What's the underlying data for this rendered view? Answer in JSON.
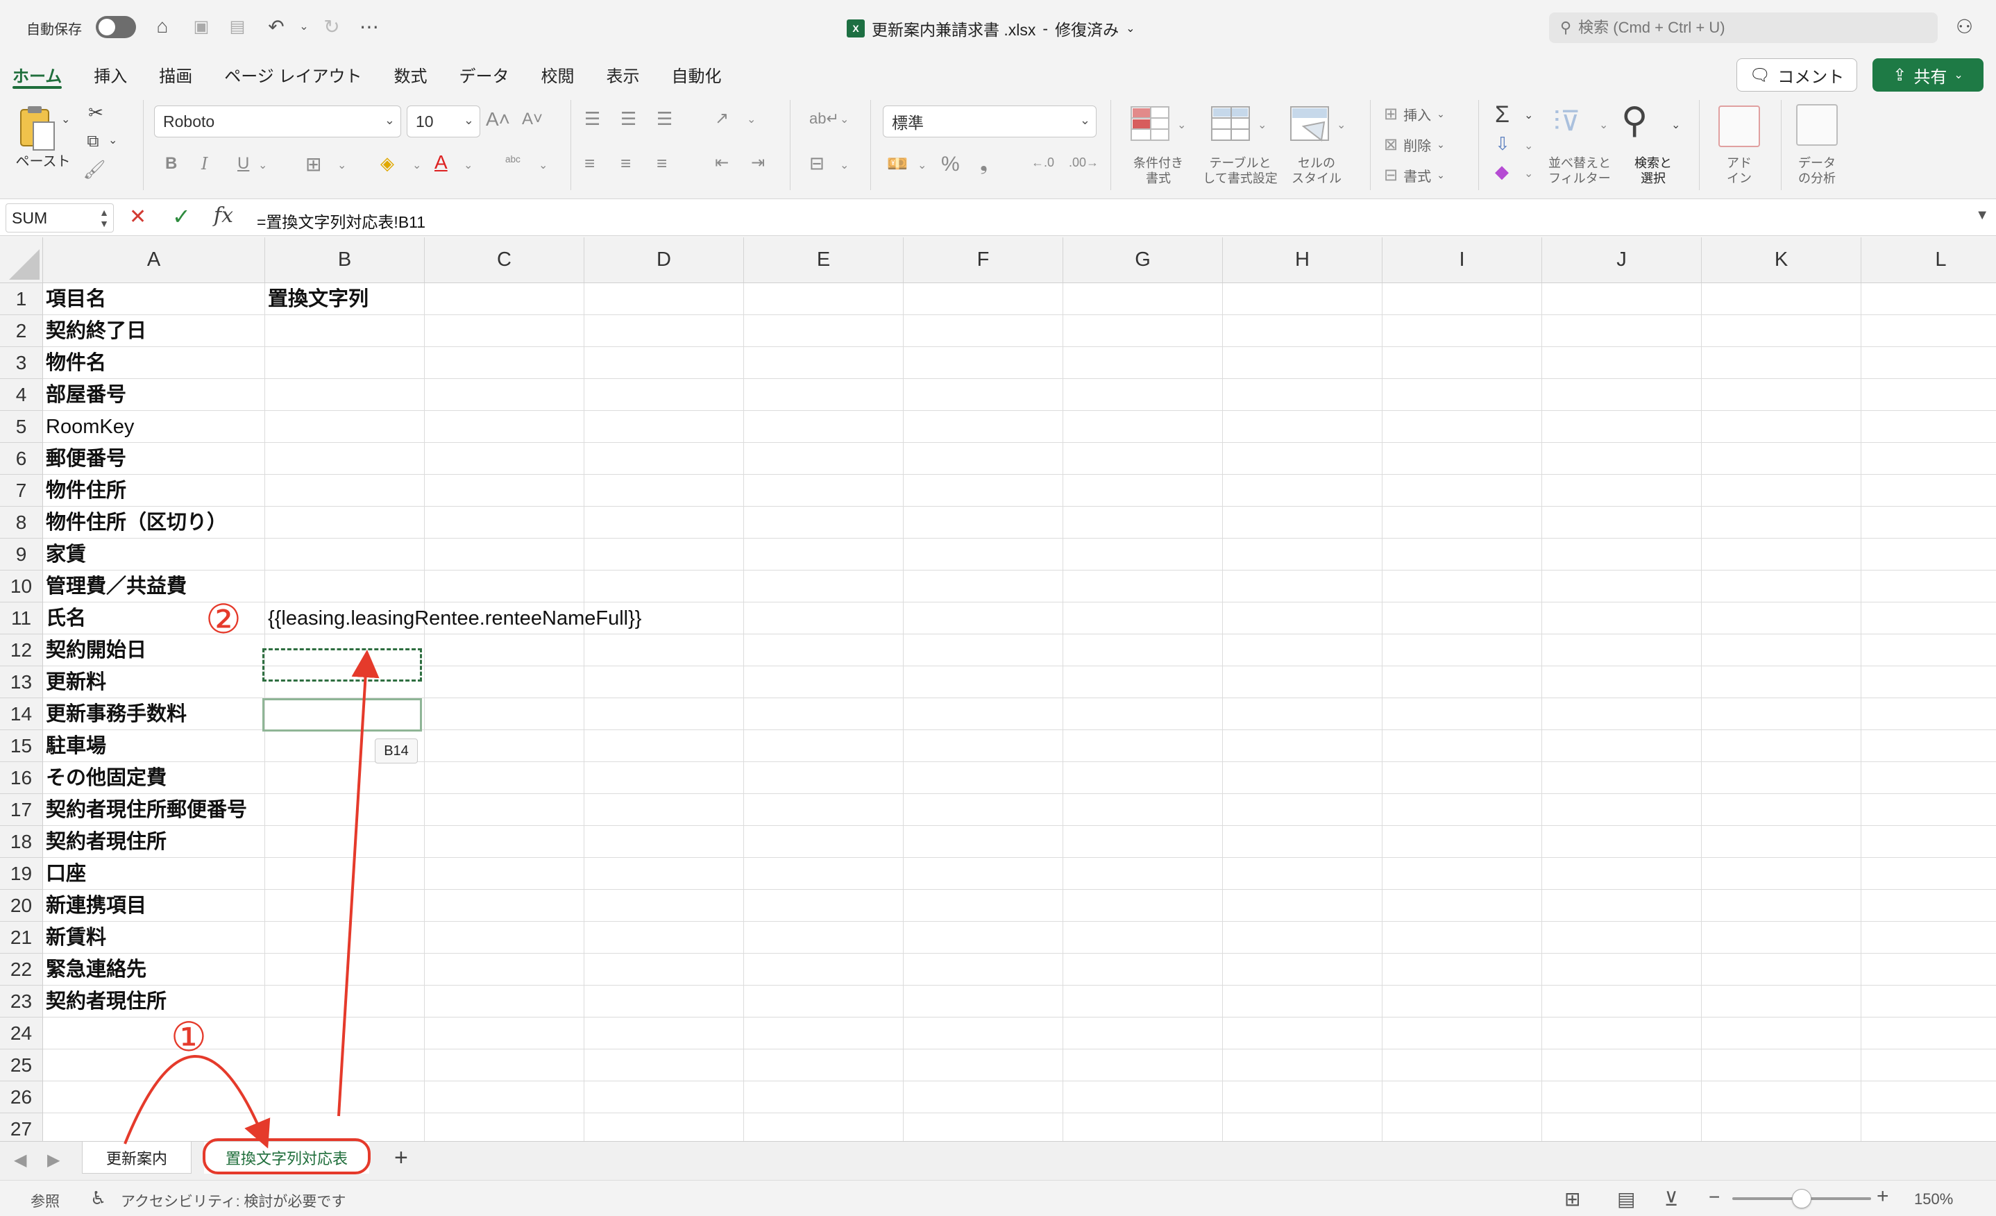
{
  "titlebar": {
    "autosave_label": "自動保存",
    "document_title": "更新案内兼請求書 .xlsx",
    "title_sep": "-",
    "status": "修復済み",
    "search_placeholder": "検索 (Cmd + Ctrl + U)"
  },
  "ribbon_tabs": [
    "ホーム",
    "挿入",
    "描画",
    "ページ レイアウト",
    "数式",
    "データ",
    "校閲",
    "表示",
    "自動化"
  ],
  "actions": {
    "comment": "コメント",
    "share": "共有"
  },
  "ribbon": {
    "paste_label": "ペースト",
    "font_name": "Roboto",
    "font_size": "10",
    "number_format": "標準",
    "cond_format": [
      "条件付き",
      "書式"
    ],
    "table_format": [
      "テーブルと",
      "して書式設定"
    ],
    "cell_style": [
      "セルの",
      "スタイル"
    ],
    "insert": "挿入",
    "delete": "削除",
    "format": "書式",
    "sort_filter": [
      "並べ替えと",
      "フィルター"
    ],
    "find_select": [
      "検索と",
      "選択"
    ],
    "addin": [
      "アド",
      "イン"
    ],
    "analyze": [
      "データ",
      "の分析"
    ]
  },
  "formula_bar": {
    "name_box": "SUM",
    "formula": "=置換文字列対応表!B11"
  },
  "grid": {
    "columns": [
      "A",
      "B",
      "C",
      "D",
      "E",
      "F",
      "G",
      "H",
      "I",
      "J",
      "K",
      "L"
    ],
    "rows": [
      "1",
      "2",
      "3",
      "4",
      "5",
      "6",
      "7",
      "8",
      "9",
      "10",
      "11",
      "12",
      "13",
      "14",
      "15",
      "16",
      "17",
      "18",
      "19",
      "20",
      "21",
      "22",
      "23",
      "24",
      "25",
      "26",
      "27"
    ],
    "col_a": [
      "項目名",
      "契約終了日",
      "物件名",
      "部屋番号",
      "RoomKey",
      "郵便番号",
      "物件住所",
      "物件住所（区切り）",
      "家賃",
      "管理費／共益費",
      "氏名",
      "契約開始日",
      "更新料",
      "更新事務手数料",
      "駐車場",
      "その他固定費",
      "契約者現住所郵便番号",
      "契約者現住所",
      "口座",
      "新連携項目",
      "新賃料",
      "緊急連絡先",
      "契約者現住所",
      "",
      "",
      "",
      ""
    ],
    "col_b": [
      "置換文字列",
      "",
      "",
      "",
      "",
      "",
      "",
      "",
      "",
      "",
      "{{leasing.leasingRentee.renteeNameFull}}",
      "",
      "",
      "",
      "",
      "",
      "",
      "",
      "",
      "",
      "",
      "",
      "",
      "",
      "",
      "",
      ""
    ],
    "tooltip": "B14"
  },
  "annotations": {
    "step1": "①",
    "step2": "②",
    "arrow_color": "#e53a2b"
  },
  "sheets": [
    "更新案内",
    "置換文字列対応表"
  ],
  "status_bar": {
    "mode": "参照",
    "accessibility": "アクセシビリティ: 検討が必要です",
    "zoom": "150%",
    "zoom_fraction": 0.5
  }
}
